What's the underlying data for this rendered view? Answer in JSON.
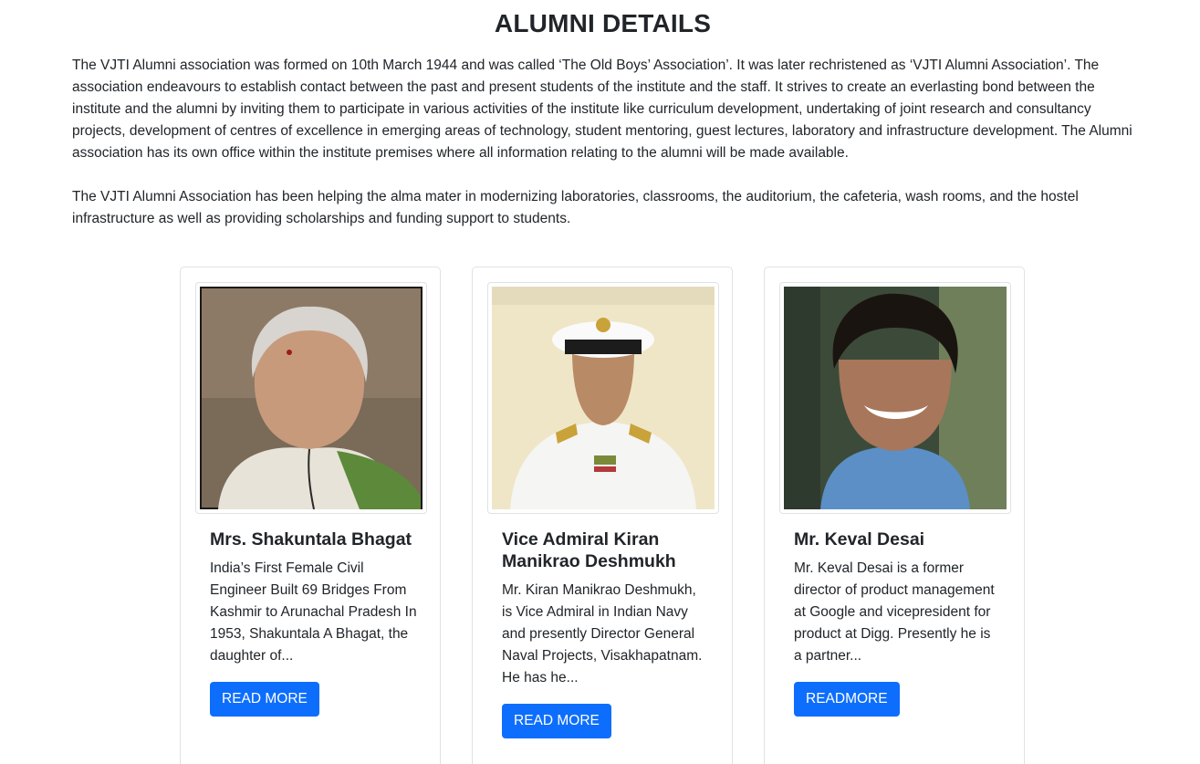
{
  "page": {
    "title": "ALUMNI DETAILS",
    "intro_paragraphs": [
      "The VJTI Alumni association was formed on 10th March 1944 and was called ‘The Old Boys’ Association’. It was later rechristened as ‘VJTI Alumni Association’. The association endeavours to establish contact between the past and present students of the institute and the staff. It strives to create an everlasting bond between the institute and the alumni by inviting them to participate in various activities of the institute like curriculum development, undertaking of joint research and consultancy projects, development of centres of excellence in emerging areas of technology, student mentoring, guest lectures, laboratory and infrastructure development. The Alumni association has its own office within the institute premises where all information relating to the alumni will be made available.",
      "The VJTI Alumni Association has been helping the alma mater in modernizing laboratories, classrooms, the auditorium, the cafeteria, wash rooms, and the hostel infrastructure as well as providing scholarships and funding support to students."
    ]
  },
  "alumni": [
    {
      "name": "Mrs. Shakuntala Bhagat",
      "description": "India’s First Female Civil Engineer Built 69 Bridges From Kashmir to Arunachal Pradesh In 1953, Shakuntala A Bhagat, the daughter of...",
      "button_label": "READ MORE"
    },
    {
      "name": "Vice Admiral Kiran Manikrao Deshmukh",
      "description": "Mr. Kiran Manikrao Deshmukh, is Vice Admiral in Indian Navy and presently Director General Naval Projects, Visakhapatnam. He has he...",
      "button_label": "READ MORE"
    },
    {
      "name": "Mr. Keval Desai",
      "description": "Mr. Keval Desai is a former director of product management at Google and vicepresident for product at Digg. Presently he is a partner...",
      "button_label": "READMORE"
    }
  ],
  "colors": {
    "primary_button": "#0d6efd",
    "card_border": "#dee2e6",
    "text": "#212529"
  }
}
